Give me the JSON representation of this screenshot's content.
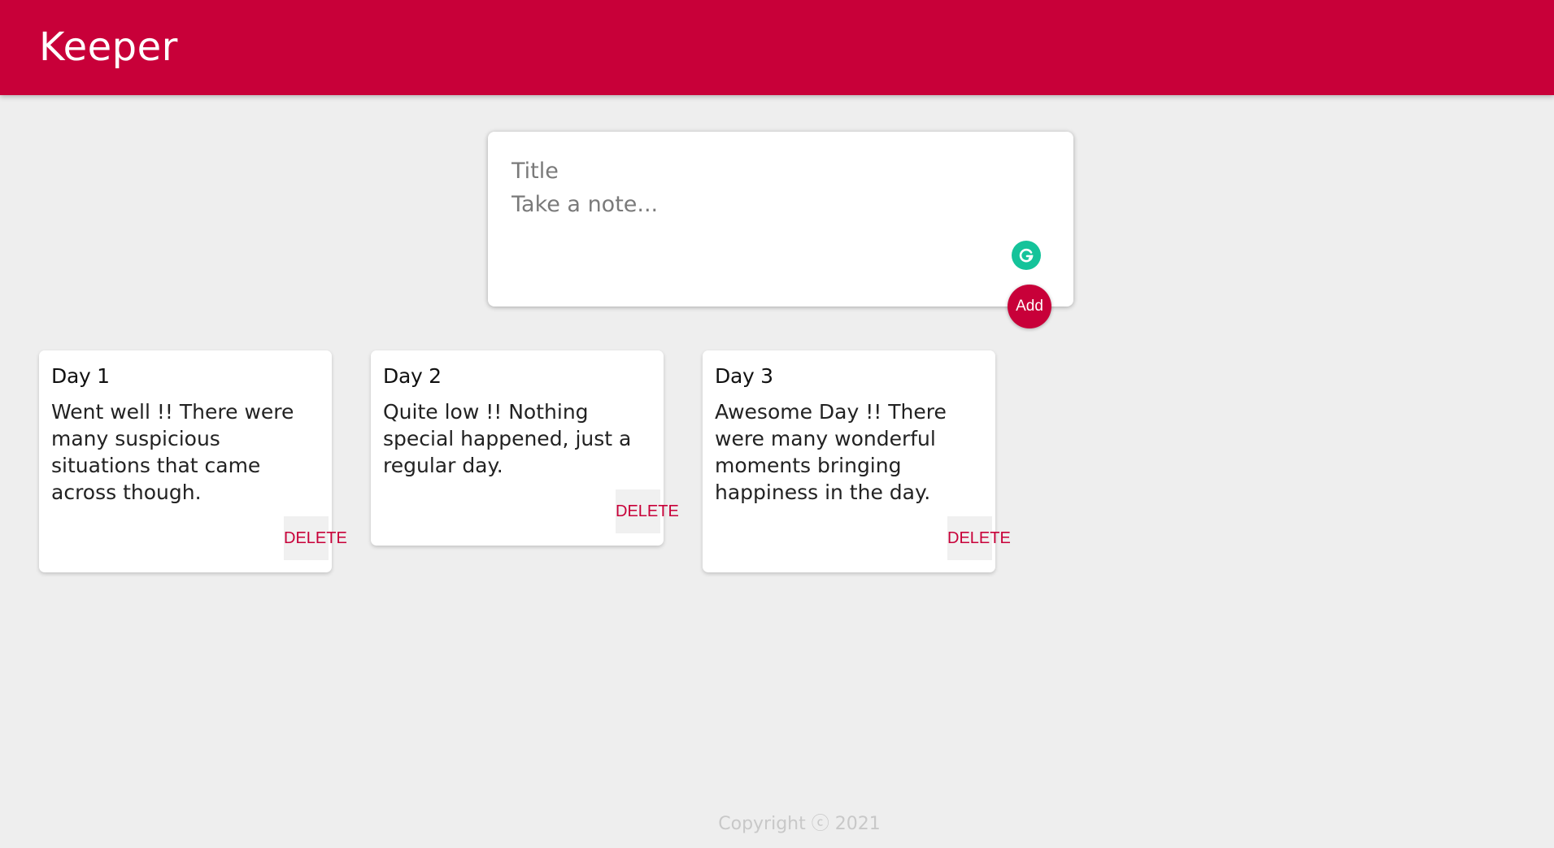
{
  "header": {
    "brand": "Keeper"
  },
  "create_note": {
    "title_placeholder": "Title",
    "content_placeholder": "Take a note...",
    "add_label": "Add"
  },
  "notes": [
    {
      "title": "Day 1",
      "content": "Went well !! There were many suspicious situations that came across though.",
      "delete_label": "DELETE"
    },
    {
      "title": "Day 2",
      "content": "Quite low !! Nothing special happened, just a regular day.",
      "delete_label": "DELETE"
    },
    {
      "title": "Day 3",
      "content": "Awesome Day !! There were many wonderful moments bringing happiness in the day.",
      "delete_label": "DELETE"
    }
  ],
  "footer": {
    "copyright": "Copyright ⓒ 2021"
  },
  "colors": {
    "accent": "#c80039",
    "background": "#eeeeee",
    "grammarly": "#15c39a"
  }
}
